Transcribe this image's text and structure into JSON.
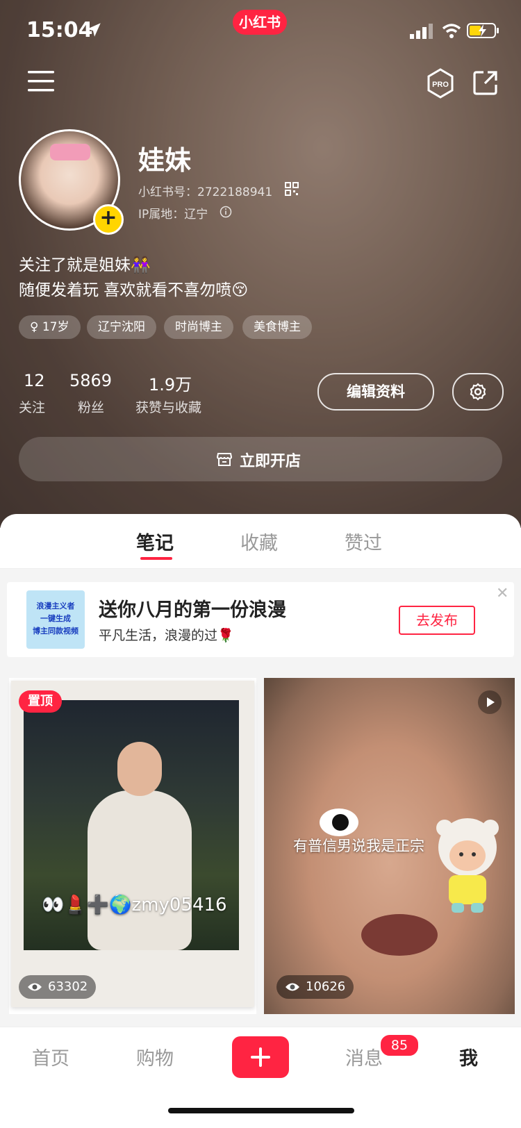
{
  "status_bar": {
    "time": "15:04"
  },
  "app": {
    "logo_text": "小红书",
    "accent": "#ff2442"
  },
  "profile": {
    "nickname": "娃妹",
    "id_line": "小红书号：2722188941",
    "ip_line": "IP属地：辽宁",
    "bio_line1": "关注了就是姐妹👭",
    "bio_line2": "随便发着玩 喜欢就看不喜勿喷😚",
    "tags": [
      "♀ 17岁",
      "辽宁沈阳",
      "时尚博主",
      "美食博主"
    ],
    "stats": [
      {
        "value": "12",
        "label": "关注"
      },
      {
        "value": "5869",
        "label": "粉丝"
      },
      {
        "value": "1.9万",
        "label": "获赞与收藏"
      }
    ],
    "edit_label": "编辑资料",
    "shop_label": "立即开店"
  },
  "tabs": {
    "notes": "笔记",
    "collections": "收藏",
    "liked": "赞过",
    "active": "notes"
  },
  "promo": {
    "title": "送你八月的第一份浪漫",
    "subtitle": "平凡生活，浪漫的过🌹",
    "button": "去发布",
    "thumb_text": [
      "浪漫主义者",
      "一键生成",
      "博主同款视频"
    ]
  },
  "cards": [
    {
      "pinned_label": "置顶",
      "overlay_text": "👀💄➕🌍zmy05416",
      "views": "63302"
    },
    {
      "overlay_text": "有普信男说我是正宗",
      "views": "10626"
    }
  ],
  "bottom_nav": {
    "home": "首页",
    "shopping": "购物",
    "messages": "消息",
    "messages_badge": "85",
    "me": "我"
  }
}
